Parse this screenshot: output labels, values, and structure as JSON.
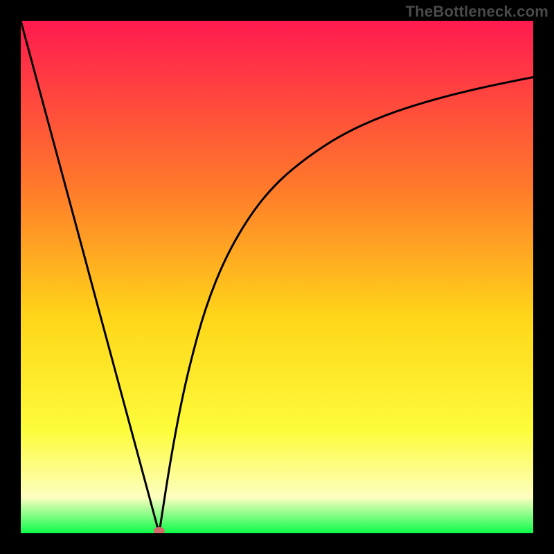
{
  "watermark": "TheBottleneck.com",
  "colors": {
    "gradient_top": "#ff1a4f",
    "gradient_upper_mid": "#ff7b2a",
    "gradient_mid": "#ffd619",
    "gradient_yellow": "#fdfc3b",
    "gradient_pale_yellow": "#fdfec0",
    "gradient_green": "#0cfb49",
    "curve": "#000000",
    "marker": "#d46a6a",
    "frame": "#000000"
  },
  "chart_data": {
    "type": "line",
    "title": "",
    "xlabel": "",
    "ylabel": "",
    "xlim": [
      0,
      100
    ],
    "ylim": [
      0,
      100
    ],
    "x_min_at": 27,
    "marker": {
      "x": 27,
      "y": 0
    },
    "left_branch": {
      "x": [
        0,
        3,
        6,
        9,
        12,
        15,
        18,
        21,
        24,
        27
      ],
      "y": [
        100,
        88.9,
        77.8,
        66.7,
        55.6,
        44.4,
        33.3,
        22.2,
        11.1,
        0
      ]
    },
    "right_branch": {
      "x": [
        27,
        29,
        31,
        33,
        36,
        40,
        45,
        50,
        56,
        63,
        71,
        80,
        90,
        100
      ],
      "y": [
        0,
        13,
        24,
        33,
        44,
        54,
        62.5,
        68.5,
        73.5,
        78,
        81.6,
        84.5,
        87,
        89
      ]
    }
  }
}
